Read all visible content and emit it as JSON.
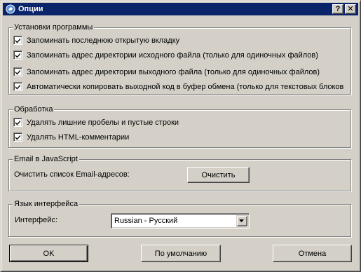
{
  "window": {
    "title": "Опции",
    "help_glyph": "?",
    "close_glyph": "✕",
    "titlebar_color": "#0a246a",
    "face_color": "#d4d0c8"
  },
  "program_settings": {
    "label": "Установки программы",
    "items": [
      {
        "label": "Запоминать последнюю открытую вкладку",
        "checked": true
      },
      {
        "label": "Запоминать адрес директории исходного файла (только для одиночных файлов)",
        "checked": true
      },
      {
        "label": "Запоминать адрес директории выходного файла (только для одиночных файлов)",
        "checked": true
      },
      {
        "label": "Автоматически копировать выходной код в буфер обмена (только для текстовых блоков",
        "checked": true
      }
    ]
  },
  "processing": {
    "label": "Обработка",
    "items": [
      {
        "label": "Удалять лишние пробелы и пустые строки",
        "checked": true
      },
      {
        "label": "Удалять HTML-комментарии",
        "checked": true
      }
    ]
  },
  "email_js": {
    "label": "Email в JavaScript",
    "clear_text": "Очистить список Email-адресов:",
    "clear_button": "Очистить"
  },
  "interface_language": {
    "label": "Язык интерфейса",
    "field_label": "Интерфейс:",
    "selected": "Russian - Русский"
  },
  "footer": {
    "ok": "OK",
    "defaults": "По умолчанию",
    "cancel": "Отмена"
  }
}
